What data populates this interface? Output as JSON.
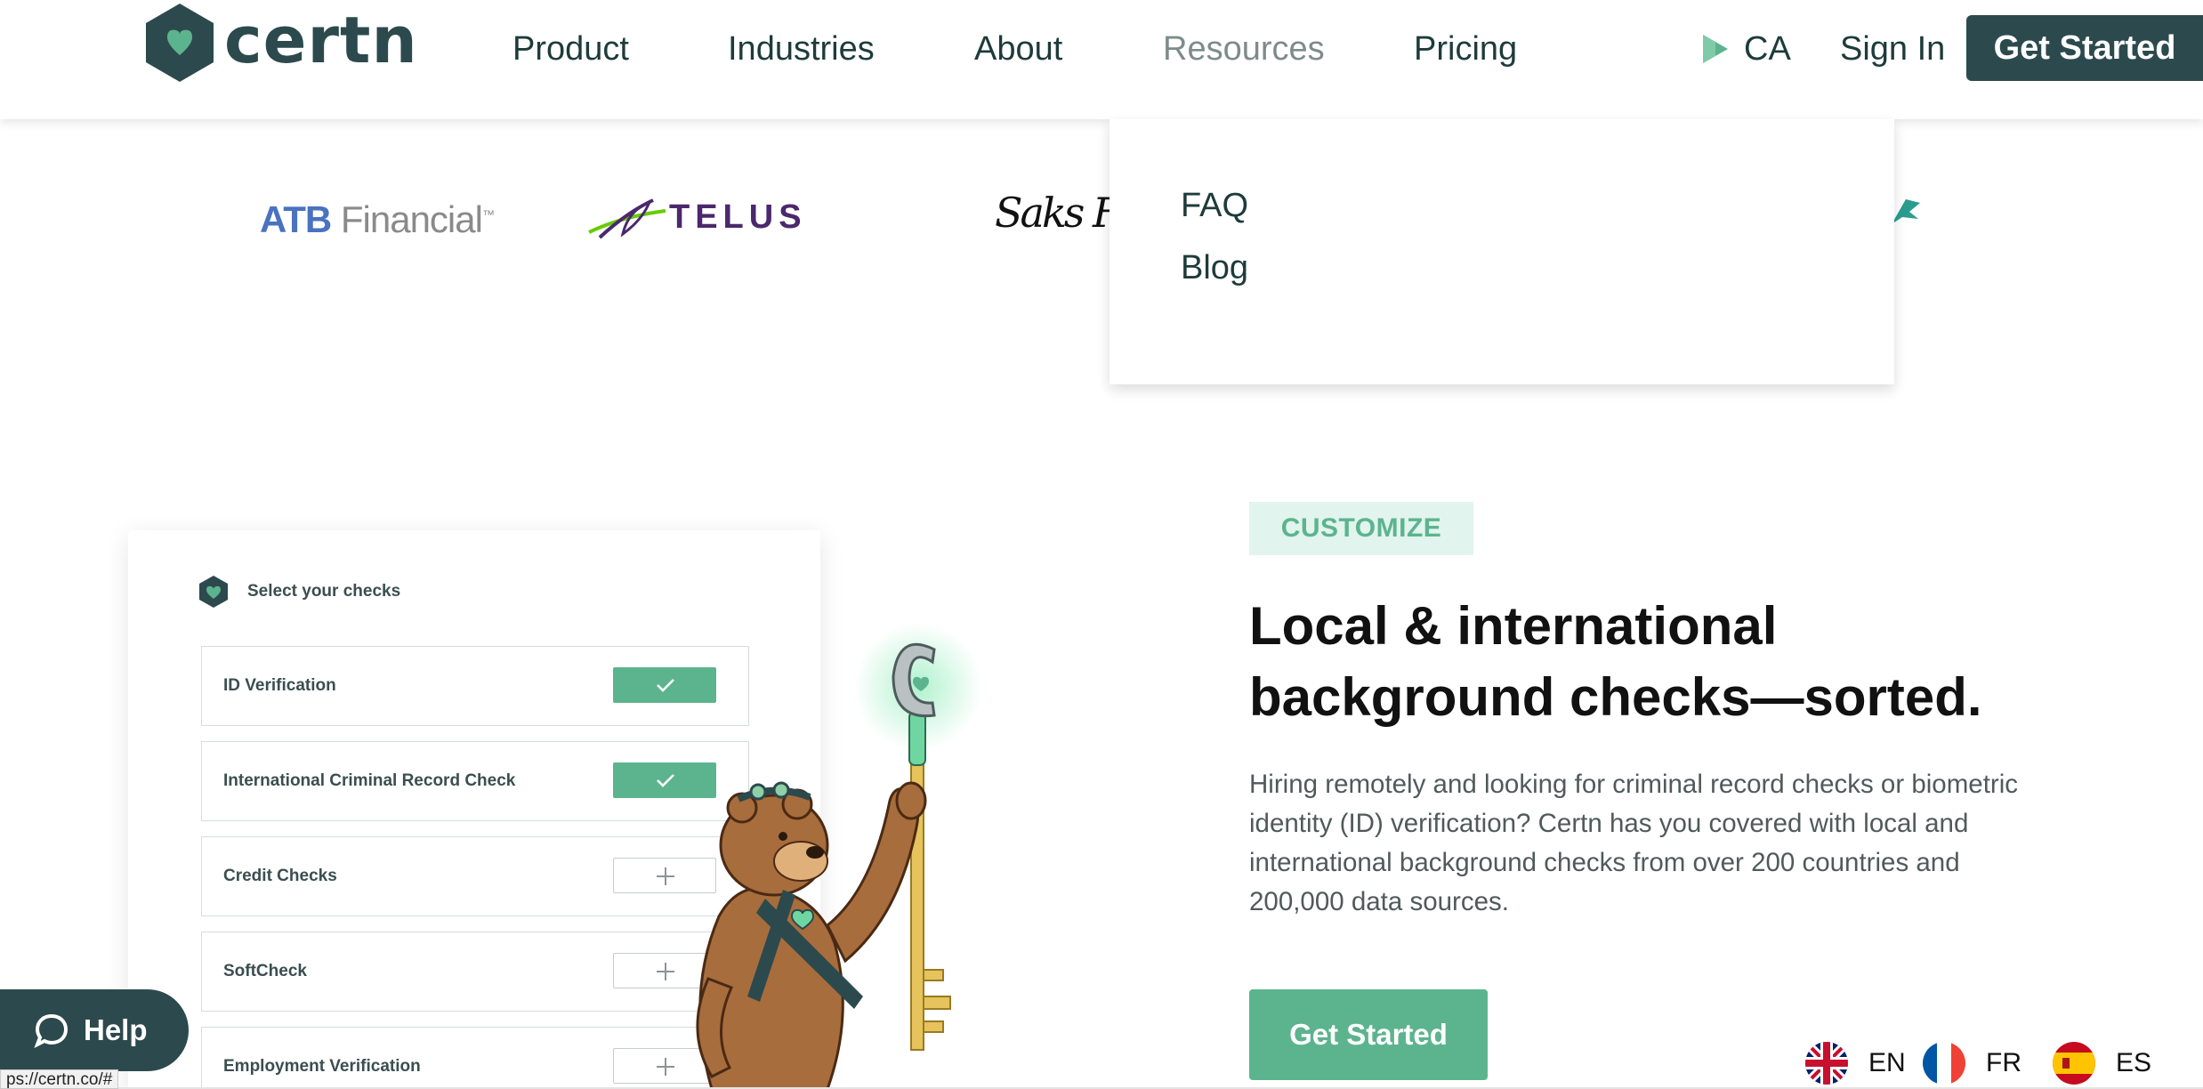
{
  "header": {
    "brand": "certn",
    "nav": [
      "Product",
      "Industries",
      "About",
      "Resources",
      "Pricing"
    ],
    "region": "CA",
    "sign_in": "Sign In",
    "get_started": "Get Started"
  },
  "resources_menu": {
    "items": [
      "FAQ",
      "Blog"
    ]
  },
  "partners": {
    "atb_bold": "ATB",
    "atb_rest": " Financial",
    "atb_tm": "™",
    "telus": "TELUS",
    "saks": "Saks Fifth"
  },
  "checks_card": {
    "title": "Select your checks",
    "rows": [
      {
        "label": "ID Verification",
        "selected": true
      },
      {
        "label": "International Criminal Record Check",
        "selected": true
      },
      {
        "label": "Credit Checks",
        "selected": false
      },
      {
        "label": "SoftCheck",
        "selected": false
      },
      {
        "label": "Employment Verification",
        "selected": false
      }
    ]
  },
  "hero": {
    "tag": "CUSTOMIZE",
    "headline_line1": "Local & international",
    "headline_line2": "background checks—sorted.",
    "paragraph": "Hiring remotely and looking for criminal record checks or biometric identity (ID) verification? Certn has you covered with local and international background checks from over 200 countries and 200,000 data sources.",
    "cta": "Get Started"
  },
  "help": {
    "label": "Help"
  },
  "status_bar": {
    "url": "ps://certn.co/#"
  },
  "languages": [
    {
      "code": "EN",
      "flag": "uk-flag-icon"
    },
    {
      "code": "FR",
      "flag": "france-flag-icon"
    },
    {
      "code": "ES",
      "flag": "spain-flag-icon"
    }
  ],
  "colors": {
    "brand_dark": "#2c4a4d",
    "brand_green": "#5cb48e",
    "tag_bg": "#e1f4ed"
  }
}
